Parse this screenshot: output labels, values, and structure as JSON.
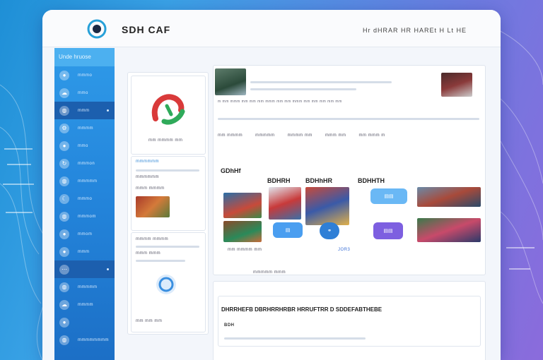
{
  "app": {
    "title": "SDH CAF",
    "top_nav": "Hr dHRAR HR HAREt H Lt HE"
  },
  "sidebar": {
    "header": "Unde hruose",
    "items": [
      {
        "label": "mmmo",
        "icon": "circle-icon"
      },
      {
        "label": "mmo",
        "icon": "cloud-icon"
      },
      {
        "label": "mmm",
        "icon": "globe-icon"
      },
      {
        "label": "mmmm",
        "icon": "gear-icon"
      },
      {
        "label": "mmo",
        "icon": "circle-icon"
      },
      {
        "label": "mmmon",
        "icon": "refresh-icon"
      },
      {
        "label": "mmmmm",
        "icon": "globe-icon"
      },
      {
        "label": "mmmo",
        "icon": "moon-icon"
      },
      {
        "label": "mmmom",
        "icon": "globe-icon"
      },
      {
        "label": "mmom",
        "icon": "circle-icon"
      },
      {
        "label": "mmm",
        "icon": "circle-icon"
      },
      {
        "label": "",
        "icon": "dots-icon"
      },
      {
        "label": "mmmmm",
        "icon": "globe-icon"
      },
      {
        "label": "mmmm",
        "icon": "cloud-icon"
      },
      {
        "label": "",
        "icon": "circle-icon"
      },
      {
        "label": "mmmmmmmm",
        "icon": "globe-icon"
      }
    ]
  },
  "left_panel": {
    "logo_caption": "mm mmmm mm",
    "section_title": "mmmmmm",
    "rows": [
      "mmmmmm",
      "mmm mmmm",
      "mmmm mmmm",
      "mmm mmm"
    ],
    "footer": "mm mm mm"
  },
  "main": {
    "breadcrumb": "m mm mmm mm mm mm mmm mm mm mmm mm mm mm mm mm",
    "tabs": [
      "mm mmmm",
      "mmmmm",
      "mmmm mm",
      "mmm mm",
      "mm mmm m"
    ],
    "section_titles": [
      "GDhHf",
      "BDHRH",
      "BDHhHR",
      "BDHHTH"
    ],
    "caption": "mm mmmm mm",
    "caption2": "mmmmm mmm",
    "news_heading": "DHRRHEFB DBRHRRHRBR HRRUFTRR D SDDEFABTHEBE",
    "news_sub": "BDH",
    "ocr_caption": "JOR3"
  },
  "colors": {
    "accent": "#2f9ae8",
    "purple": "#8b6bdc",
    "pill_blue": "#4a9ef0",
    "pill_purple": "#7d5fe0"
  }
}
